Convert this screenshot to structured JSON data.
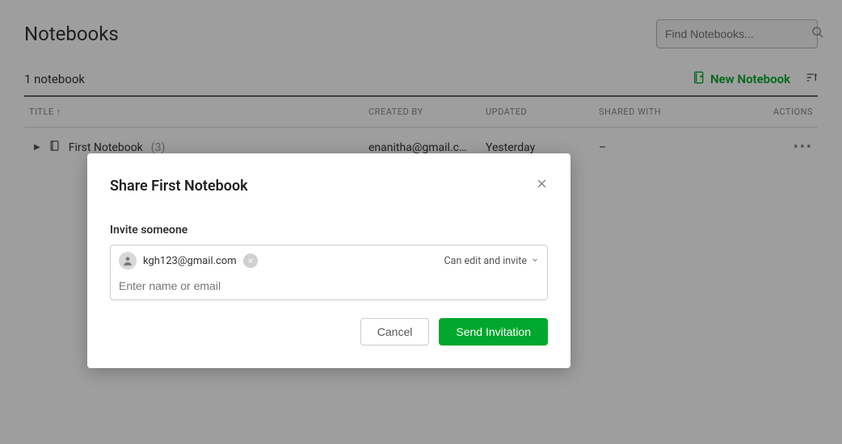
{
  "header": {
    "title": "Notebooks",
    "search_placeholder": "Find Notebooks..."
  },
  "subheader": {
    "count_text": "1 notebook",
    "new_button": "New Notebook"
  },
  "table": {
    "columns": {
      "title": "TITLE ↑",
      "created_by": "CREATED BY",
      "updated": "UPDATED",
      "shared_with": "SHARED WITH",
      "actions": "ACTIONS"
    },
    "rows": [
      {
        "title": "First Notebook",
        "count": "(3)",
        "created_by": "enanitha@gmail.c…",
        "updated": "Yesterday",
        "shared_with": "–"
      }
    ]
  },
  "modal": {
    "title": "Share First Notebook",
    "invite_label": "Invite someone",
    "chip_email": "kgh123@gmail.com",
    "permission_label": "Can edit and invite",
    "input_placeholder": "Enter name or email",
    "cancel": "Cancel",
    "send": "Send Invitation"
  }
}
